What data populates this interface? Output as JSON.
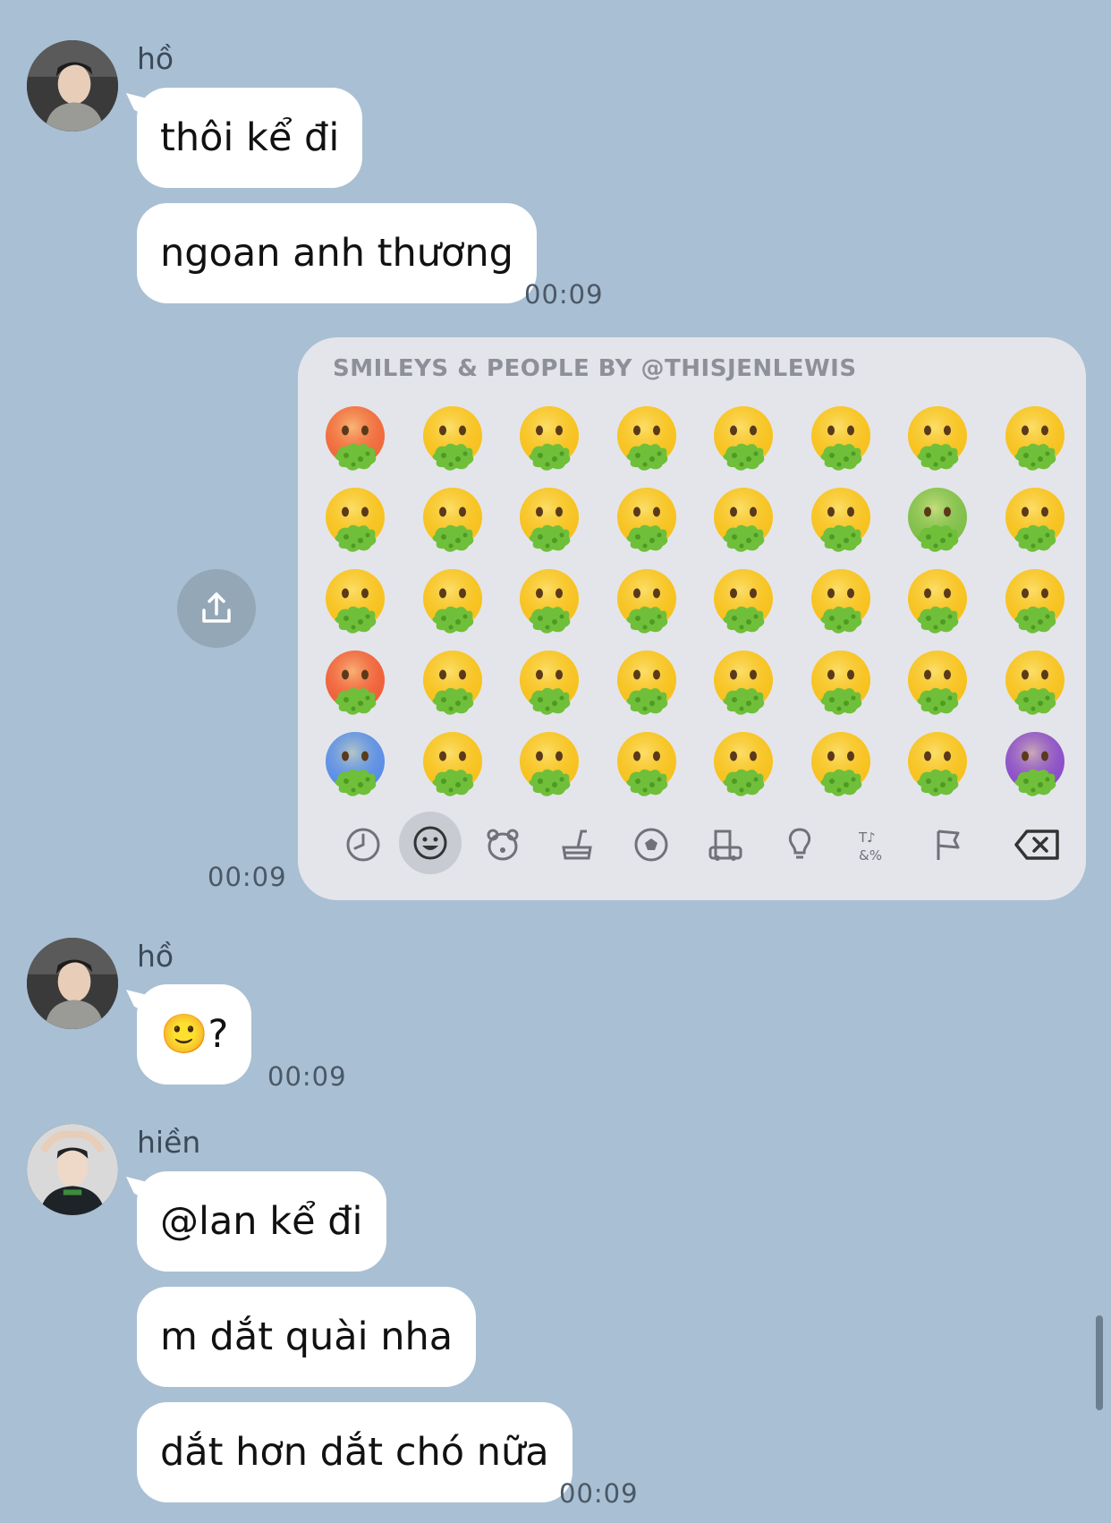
{
  "messages": [
    {
      "sender": "hồ",
      "lines": [
        "thôi kể đi",
        "ngoan anh thương"
      ],
      "time": "00:09"
    },
    {
      "sticker": {
        "title": "SMILEYS & PEOPLE BY @THISJENLEWIS"
      },
      "time": "00:09"
    },
    {
      "sender": "hồ",
      "lines": [
        "🙂?"
      ],
      "time": "00:09"
    },
    {
      "sender": "hiền",
      "lines": [
        "@lan kể đi",
        "m dắt quài nha",
        "dắt hơn dắt chó nữa"
      ],
      "time": "00:09"
    }
  ],
  "sticker_tabs": [
    "recent-icon",
    "smiley-icon",
    "animal-icon",
    "food-icon",
    "ball-icon",
    "building-icon",
    "bulb-icon",
    "symbols-icon",
    "flag-icon",
    "backspace-icon"
  ],
  "colors": {
    "background": "#a9bfd3",
    "bubble": "#ffffff",
    "keyboard_bg": "#e4e5ea",
    "vomit_green": "#6fbf3a",
    "emoji_yellow": "#f7c21f"
  }
}
